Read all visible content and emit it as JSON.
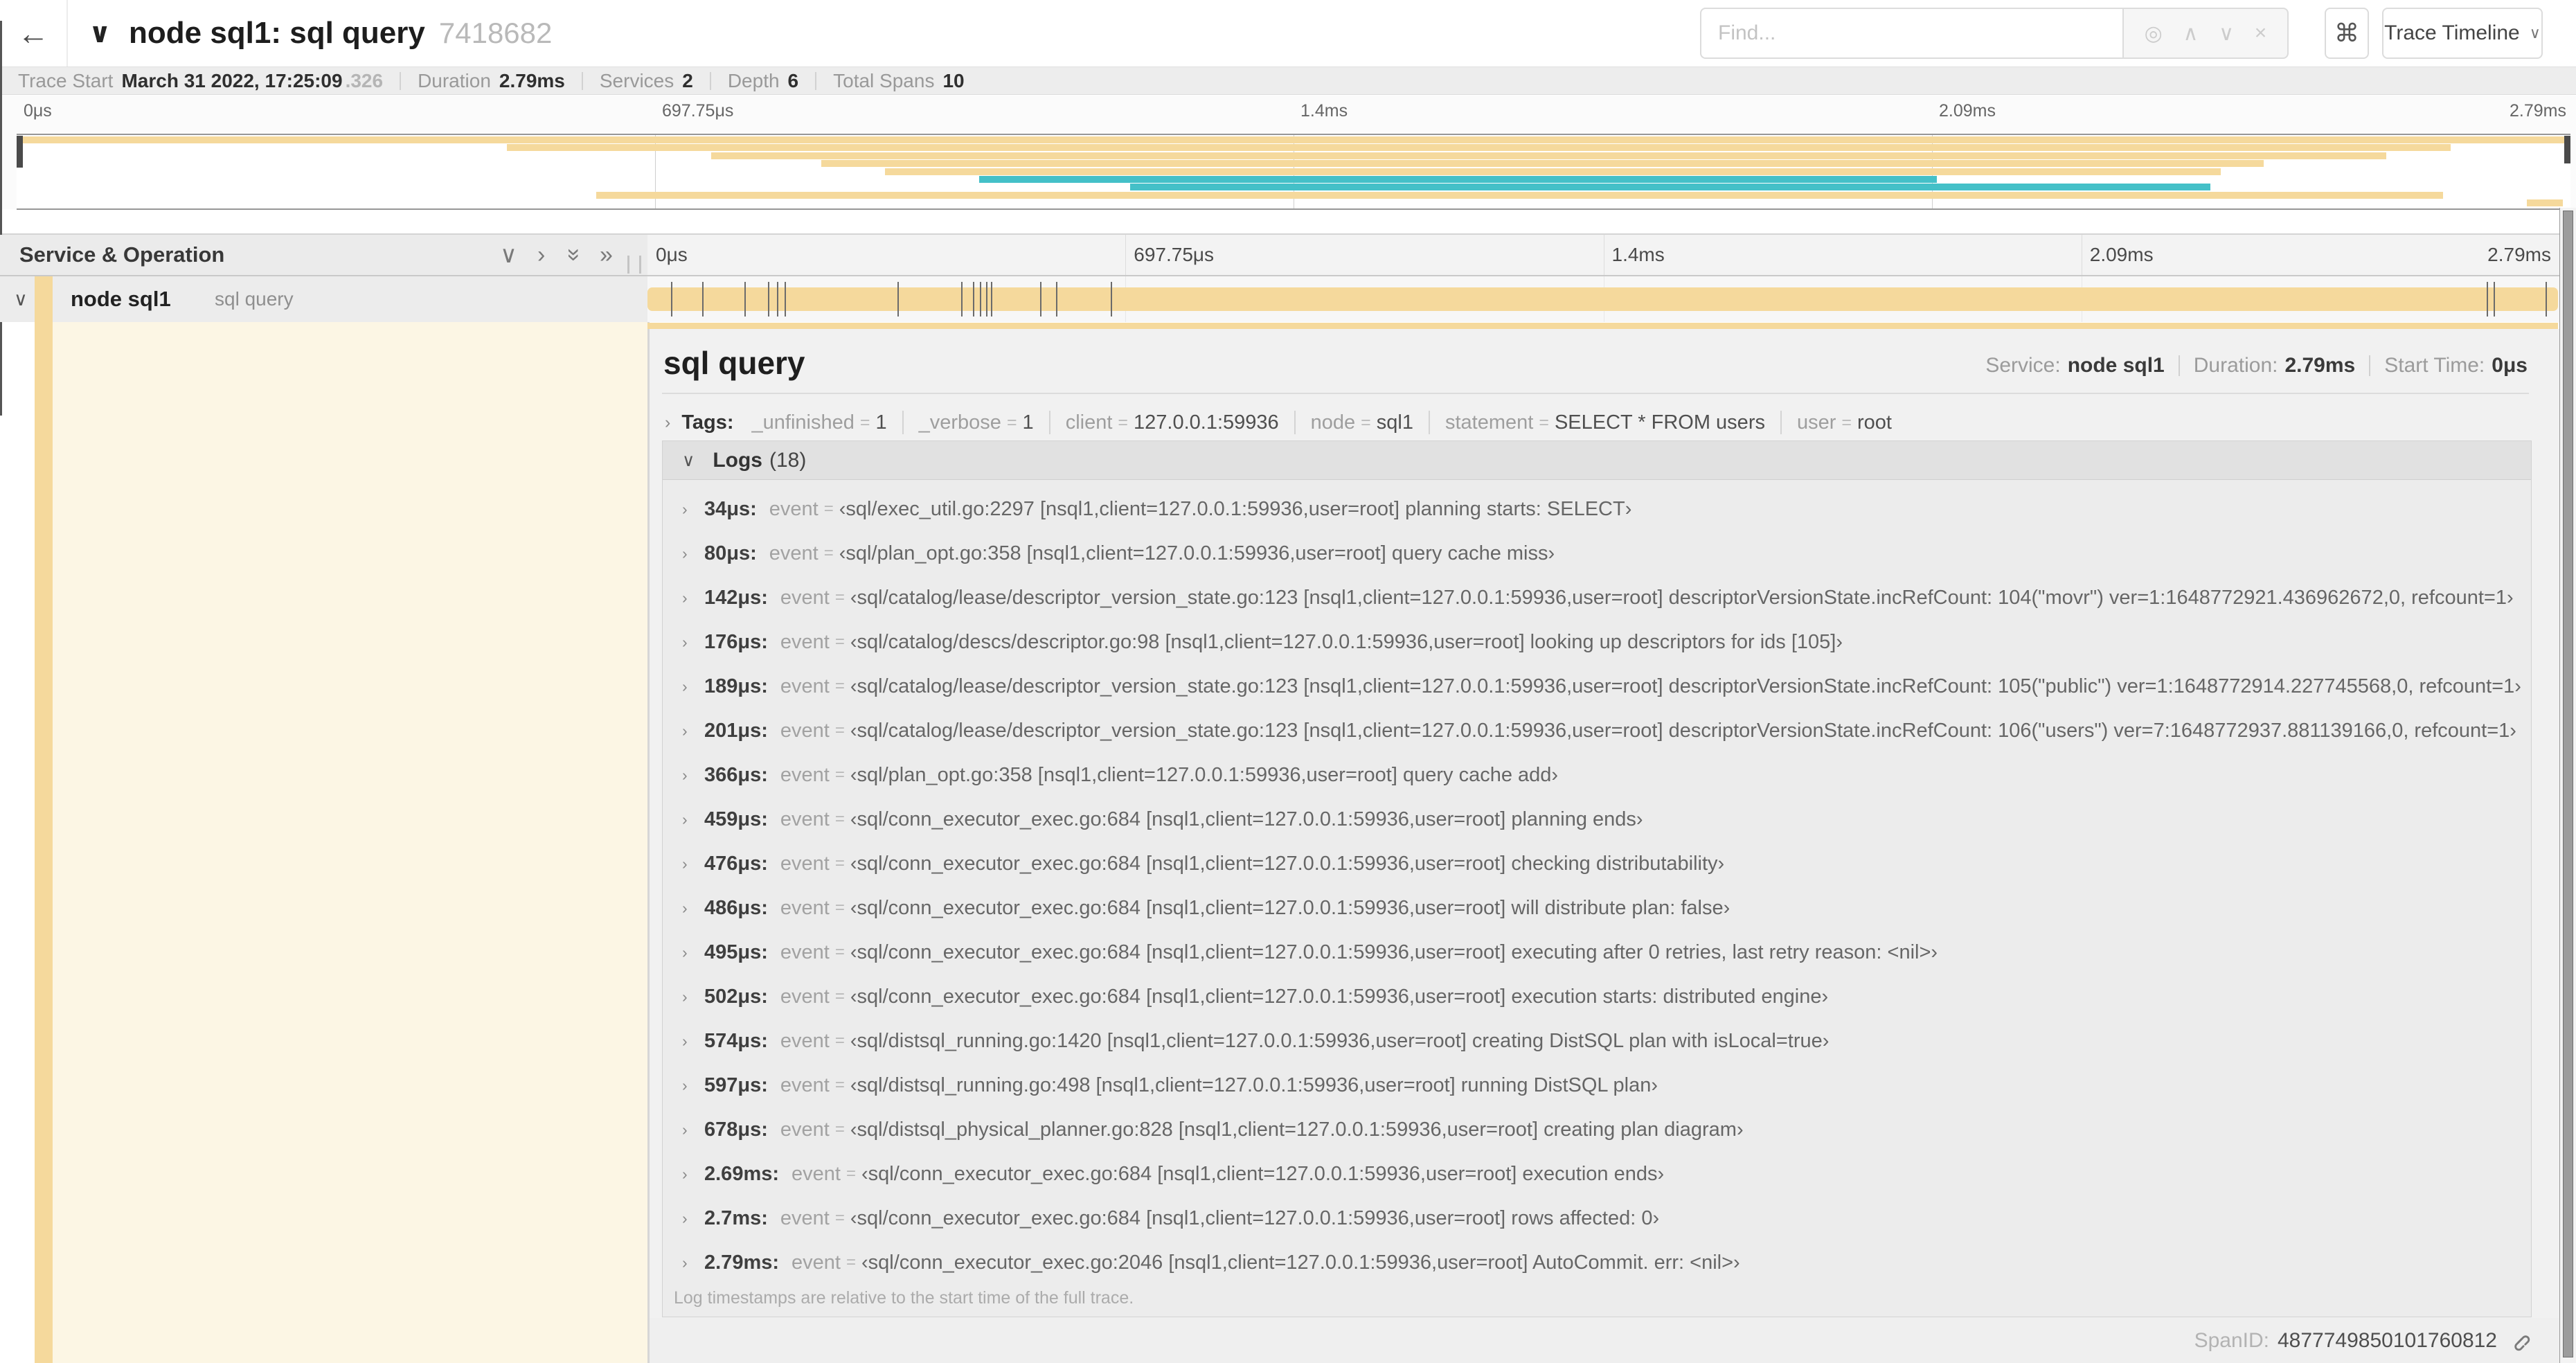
{
  "topbar": {
    "back_icon": "←",
    "collapse_caret": "∨",
    "title": "node sql1: sql query",
    "trace_id": "7418682",
    "search": {
      "placeholder": "Find...",
      "locate_icon": "◎",
      "prev_icon": "∧",
      "next_icon": "∨",
      "clear_icon": "×"
    },
    "shortcut_icon": "⌘",
    "view_selector": {
      "label": "Trace Timeline",
      "caret": "∨"
    }
  },
  "summary": {
    "items": [
      {
        "label": "Trace Start",
        "value": "March 31 2022, 17:25:09",
        "suffix": ".326"
      },
      {
        "label": "Duration",
        "value": "2.79ms",
        "suffix": ""
      },
      {
        "label": "Services",
        "value": "2",
        "suffix": ""
      },
      {
        "label": "Depth",
        "value": "6",
        "suffix": ""
      },
      {
        "label": "Total Spans",
        "value": "10",
        "suffix": ""
      }
    ]
  },
  "colors": {
    "span_orange": "#F5D99C",
    "span_teal": "#44C0C8",
    "cream_tint": "#FCF6E4",
    "tick": "#6b6b6b"
  },
  "chart_data": {
    "type": "area",
    "title": "trace minimap waterfall",
    "axis_labels": [
      "0μs",
      "697.75μs",
      "1.4ms",
      "2.09ms",
      "2.79ms"
    ],
    "duration_us": 2790,
    "spans": [
      {
        "row": 0,
        "start": 0.0,
        "end": 1.0,
        "color": "orange"
      },
      {
        "row": 1,
        "start": 0.192,
        "end": 0.953,
        "color": "orange"
      },
      {
        "row": 2,
        "start": 0.272,
        "end": 0.928,
        "color": "orange"
      },
      {
        "row": 3,
        "start": 0.315,
        "end": 0.88,
        "color": "orange"
      },
      {
        "row": 4,
        "start": 0.34,
        "end": 0.863,
        "color": "orange"
      },
      {
        "row": 5,
        "start": 0.377,
        "end": 0.752,
        "color": "teal"
      },
      {
        "row": 6,
        "start": 0.436,
        "end": 0.859,
        "color": "teal"
      },
      {
        "row": 7,
        "start": 0.227,
        "end": 0.95,
        "color": "orange"
      },
      {
        "row": 8,
        "start": 0.983,
        "end": 0.997,
        "color": "orange"
      }
    ],
    "log_tick_times_us": [
      34,
      80,
      142,
      176,
      189,
      201,
      366,
      459,
      476,
      486,
      495,
      502,
      574,
      597,
      678,
      2690,
      2700,
      2790
    ]
  },
  "span_table": {
    "column_header": "Service & Operation",
    "collapse_one_icon": "∨",
    "expand_one_icon": "›",
    "collapse_all_icon": "»",
    "expand_all_icon": "»",
    "axis_labels": [
      "0μs",
      "697.75μs",
      "1.4ms",
      "2.09ms",
      "2.79ms"
    ],
    "row": {
      "toggle_icon": "∨",
      "service": "node sql1",
      "operation": "sql query"
    }
  },
  "detail": {
    "title": "sql query",
    "meta": [
      {
        "label": "Service:",
        "value": "node sql1"
      },
      {
        "label": "Duration:",
        "value": "2.79ms"
      },
      {
        "label": "Start Time:",
        "value": "0μs"
      }
    ],
    "tags": {
      "toggle_icon": "›",
      "label": "Tags:",
      "items": [
        {
          "key": "_unfinished",
          "value": "1"
        },
        {
          "key": "_verbose",
          "value": "1"
        },
        {
          "key": "client",
          "value": "127.0.0.1:59936"
        },
        {
          "key": "node",
          "value": "sql1"
        },
        {
          "key": "statement",
          "value": "SELECT * FROM users"
        },
        {
          "key": "user",
          "value": "root"
        }
      ]
    },
    "logs": {
      "toggle_icon": "∨",
      "label": "Logs",
      "count": "(18)",
      "entry_key": "event",
      "entries": [
        {
          "time": "34μs:",
          "value": "‹sql/exec_util.go:2297 [nsql1,client=127.0.0.1:59936,user=root] planning starts: SELECT›"
        },
        {
          "time": "80μs:",
          "value": "‹sql/plan_opt.go:358 [nsql1,client=127.0.0.1:59936,user=root] query cache miss›"
        },
        {
          "time": "142μs:",
          "value": "‹sql/catalog/lease/descriptor_version_state.go:123 [nsql1,client=127.0.0.1:59936,user=root] descriptorVersionState.incRefCount: 104(\"movr\") ver=1:1648772921.436962672,0, refcount=1›"
        },
        {
          "time": "176μs:",
          "value": "‹sql/catalog/descs/descriptor.go:98 [nsql1,client=127.0.0.1:59936,user=root] looking up descriptors for ids [105]›"
        },
        {
          "time": "189μs:",
          "value": "‹sql/catalog/lease/descriptor_version_state.go:123 [nsql1,client=127.0.0.1:59936,user=root] descriptorVersionState.incRefCount: 105(\"public\") ver=1:1648772914.227745568,0, refcount=1›"
        },
        {
          "time": "201μs:",
          "value": "‹sql/catalog/lease/descriptor_version_state.go:123 [nsql1,client=127.0.0.1:59936,user=root] descriptorVersionState.incRefCount: 106(\"users\") ver=7:1648772937.881139166,0, refcount=1›"
        },
        {
          "time": "366μs:",
          "value": "‹sql/plan_opt.go:358 [nsql1,client=127.0.0.1:59936,user=root] query cache add›"
        },
        {
          "time": "459μs:",
          "value": "‹sql/conn_executor_exec.go:684 [nsql1,client=127.0.0.1:59936,user=root] planning ends›"
        },
        {
          "time": "476μs:",
          "value": "‹sql/conn_executor_exec.go:684 [nsql1,client=127.0.0.1:59936,user=root] checking distributability›"
        },
        {
          "time": "486μs:",
          "value": "‹sql/conn_executor_exec.go:684 [nsql1,client=127.0.0.1:59936,user=root] will distribute plan: false›"
        },
        {
          "time": "495μs:",
          "value": "‹sql/conn_executor_exec.go:684 [nsql1,client=127.0.0.1:59936,user=root] executing after 0 retries, last retry reason: <nil>›"
        },
        {
          "time": "502μs:",
          "value": "‹sql/conn_executor_exec.go:684 [nsql1,client=127.0.0.1:59936,user=root] execution starts: distributed engine›"
        },
        {
          "time": "574μs:",
          "value": "‹sql/distsql_running.go:1420 [nsql1,client=127.0.0.1:59936,user=root] creating DistSQL plan with isLocal=true›"
        },
        {
          "time": "597μs:",
          "value": "‹sql/distsql_running.go:498 [nsql1,client=127.0.0.1:59936,user=root] running DistSQL plan›"
        },
        {
          "time": "678μs:",
          "value": "‹sql/distsql_physical_planner.go:828 [nsql1,client=127.0.0.1:59936,user=root] creating plan diagram›"
        },
        {
          "time": "2.69ms:",
          "value": "‹sql/conn_executor_exec.go:684 [nsql1,client=127.0.0.1:59936,user=root] execution ends›"
        },
        {
          "time": "2.7ms:",
          "value": "‹sql/conn_executor_exec.go:684 [nsql1,client=127.0.0.1:59936,user=root] rows affected: 0›"
        },
        {
          "time": "2.79ms:",
          "value": "‹sql/conn_executor_exec.go:2046 [nsql1,client=127.0.0.1:59936,user=root] AutoCommit. err: <nil>›"
        }
      ],
      "footnote": "Log timestamps are relative to the start time of the full trace."
    },
    "footer": {
      "label": "SpanID:",
      "value": "4877749850101760812"
    }
  }
}
